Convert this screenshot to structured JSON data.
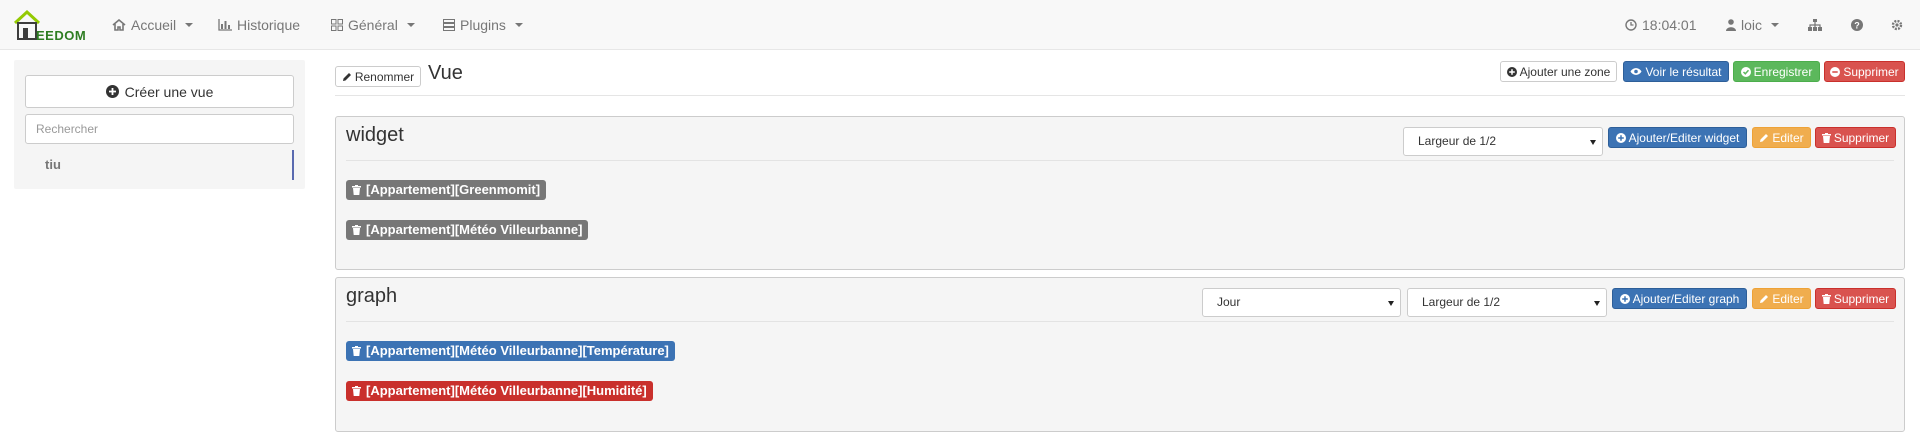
{
  "navbar": {
    "logo": "EEDOM",
    "menu": [
      {
        "label": "Accueil",
        "icon": "home-icon"
      },
      {
        "label": "Historique",
        "icon": "bar-chart-icon"
      },
      {
        "label": "Général",
        "icon": "grid-icon"
      },
      {
        "label": "Plugins",
        "icon": "list-icon"
      }
    ],
    "time": "18:04:01",
    "user": "loic"
  },
  "sidebar": {
    "create_label": "Créer une vue",
    "search_placeholder": "Rechercher",
    "views": [
      "tiu"
    ]
  },
  "header": {
    "rename_label": "Renommer",
    "title": "Vue",
    "add_zone_label": "Ajouter une zone",
    "view_result_label": "Voir le résultat",
    "save_label": "Enregistrer",
    "delete_label": "Supprimer"
  },
  "zones": [
    {
      "title": "widget",
      "width_select": "Largeur de 1/2",
      "add_label": "Ajouter/Editer widget",
      "edit_label": "Editer",
      "delete_label": "Supprimer",
      "items": [
        "[Appartement][Greenmomit]",
        "[Appartement][Météo Villeurbanne]"
      ]
    },
    {
      "title": "graph",
      "period_select": "Jour",
      "width_select": "Largeur de 1/2",
      "add_label": "Ajouter/Editer graph",
      "edit_label": "Editer",
      "delete_label": "Supprimer",
      "items": [
        "[Appartement][Météo Villeurbanne][Température]",
        "[Appartement][Météo Villeurbanne][Humidité]"
      ]
    }
  ],
  "colors": {
    "primary": "#3c73b4",
    "success": "#5cb85c",
    "danger": "#d9534f",
    "warning": "#f0ad4e",
    "label_default": "#777777",
    "logo_green": "#94ca02"
  }
}
